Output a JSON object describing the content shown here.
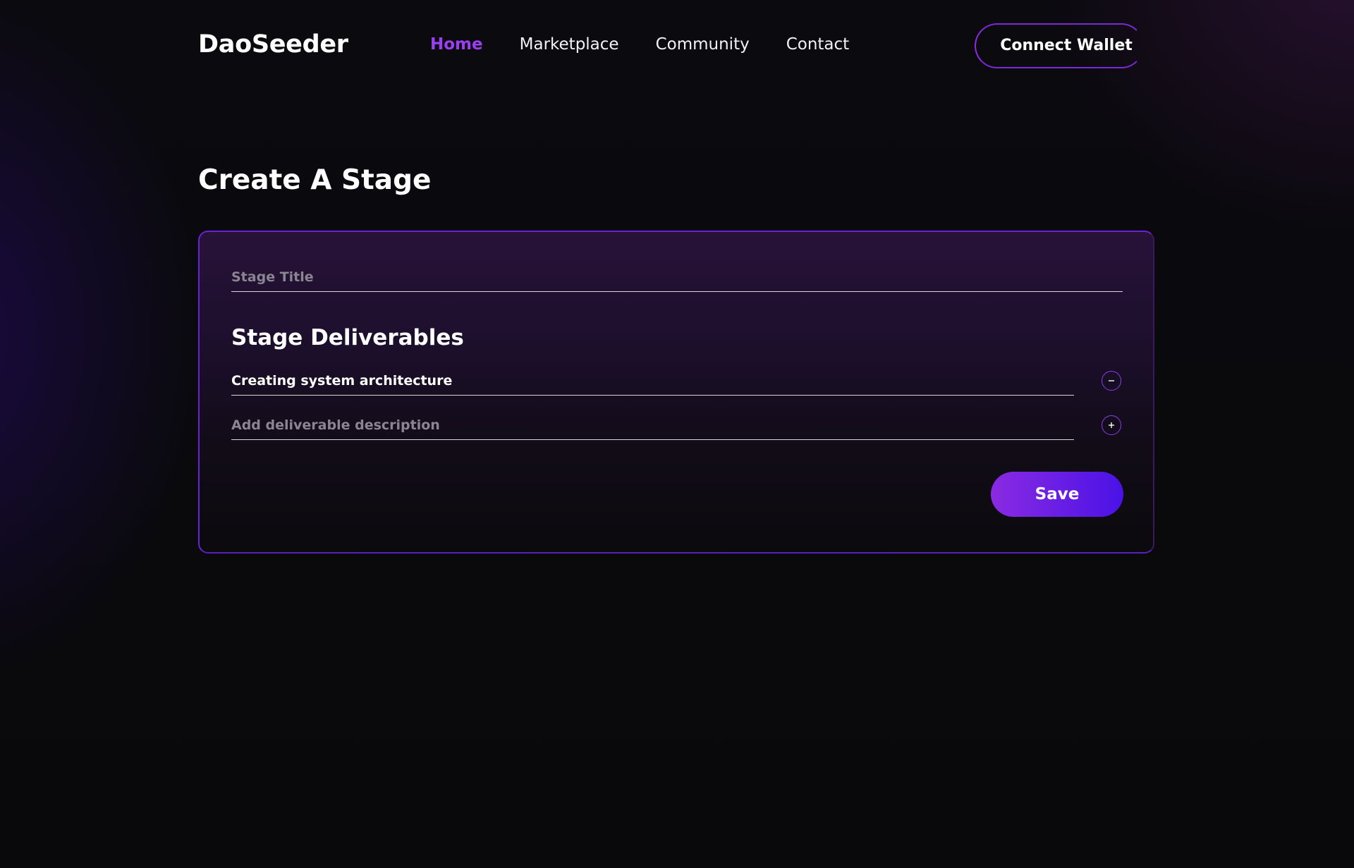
{
  "header": {
    "logo": "DaoSeeder",
    "nav": [
      {
        "label": "Home",
        "active": true
      },
      {
        "label": "Marketplace",
        "active": false
      },
      {
        "label": "Community",
        "active": false
      },
      {
        "label": "Contact",
        "active": false
      }
    ],
    "connect_wallet_label": "Connect Wallet"
  },
  "main": {
    "title": "Create A Stage",
    "form": {
      "stage_title": {
        "value": "",
        "placeholder": "Stage Title"
      },
      "deliverables_heading": "Stage Deliverables",
      "deliverables": [
        {
          "value": "Creating system architecture",
          "placeholder": "",
          "action": "remove",
          "action_icon": "minus-icon"
        },
        {
          "value": "",
          "placeholder": "Add deliverable description",
          "action": "add",
          "action_icon": "plus-icon"
        }
      ],
      "save_label": "Save"
    }
  },
  "colors": {
    "accent": "#9b3ff0",
    "button_gradient_start": "#8a2be2",
    "button_gradient_end": "#4a12e6",
    "background": "#0a0a0b",
    "card_border": "#6a22d8"
  }
}
